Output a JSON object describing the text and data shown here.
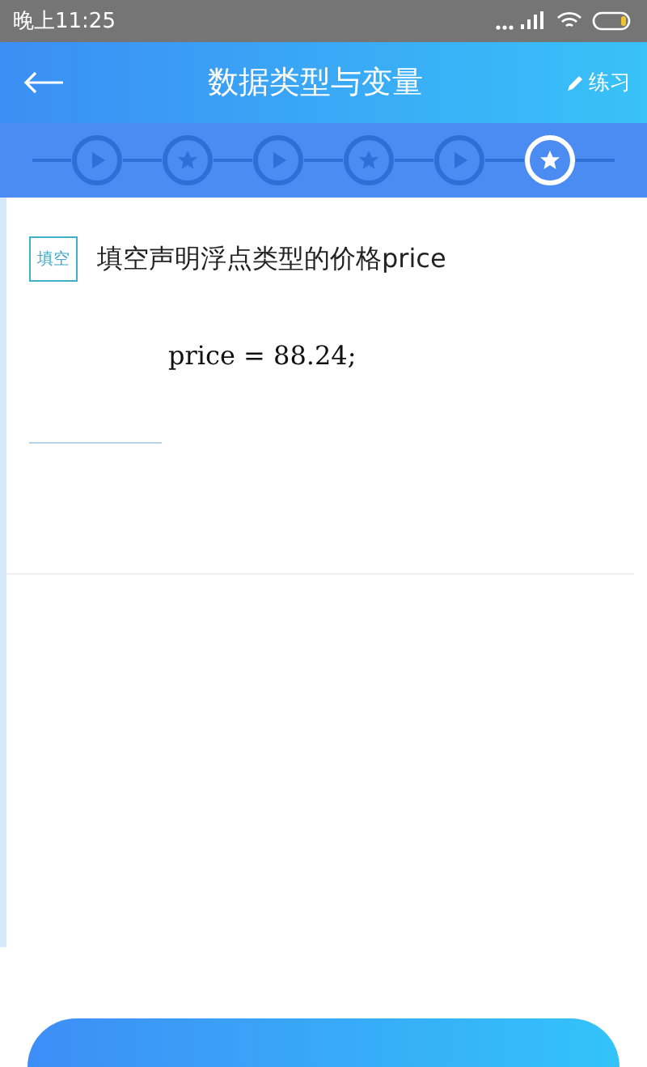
{
  "status_bar": {
    "time": "晚上11:25"
  },
  "header": {
    "title": "数据类型与变量",
    "action": "练习"
  },
  "steps": [
    {
      "kind": "play",
      "selected": false
    },
    {
      "kind": "star",
      "selected": false
    },
    {
      "kind": "play",
      "selected": false
    },
    {
      "kind": "star",
      "selected": false
    },
    {
      "kind": "play",
      "selected": false
    },
    {
      "kind": "star",
      "selected": true
    }
  ],
  "question": {
    "tag": "填空",
    "text": "填空声明浮点类型的价格price",
    "code": "price = 88.24;"
  }
}
